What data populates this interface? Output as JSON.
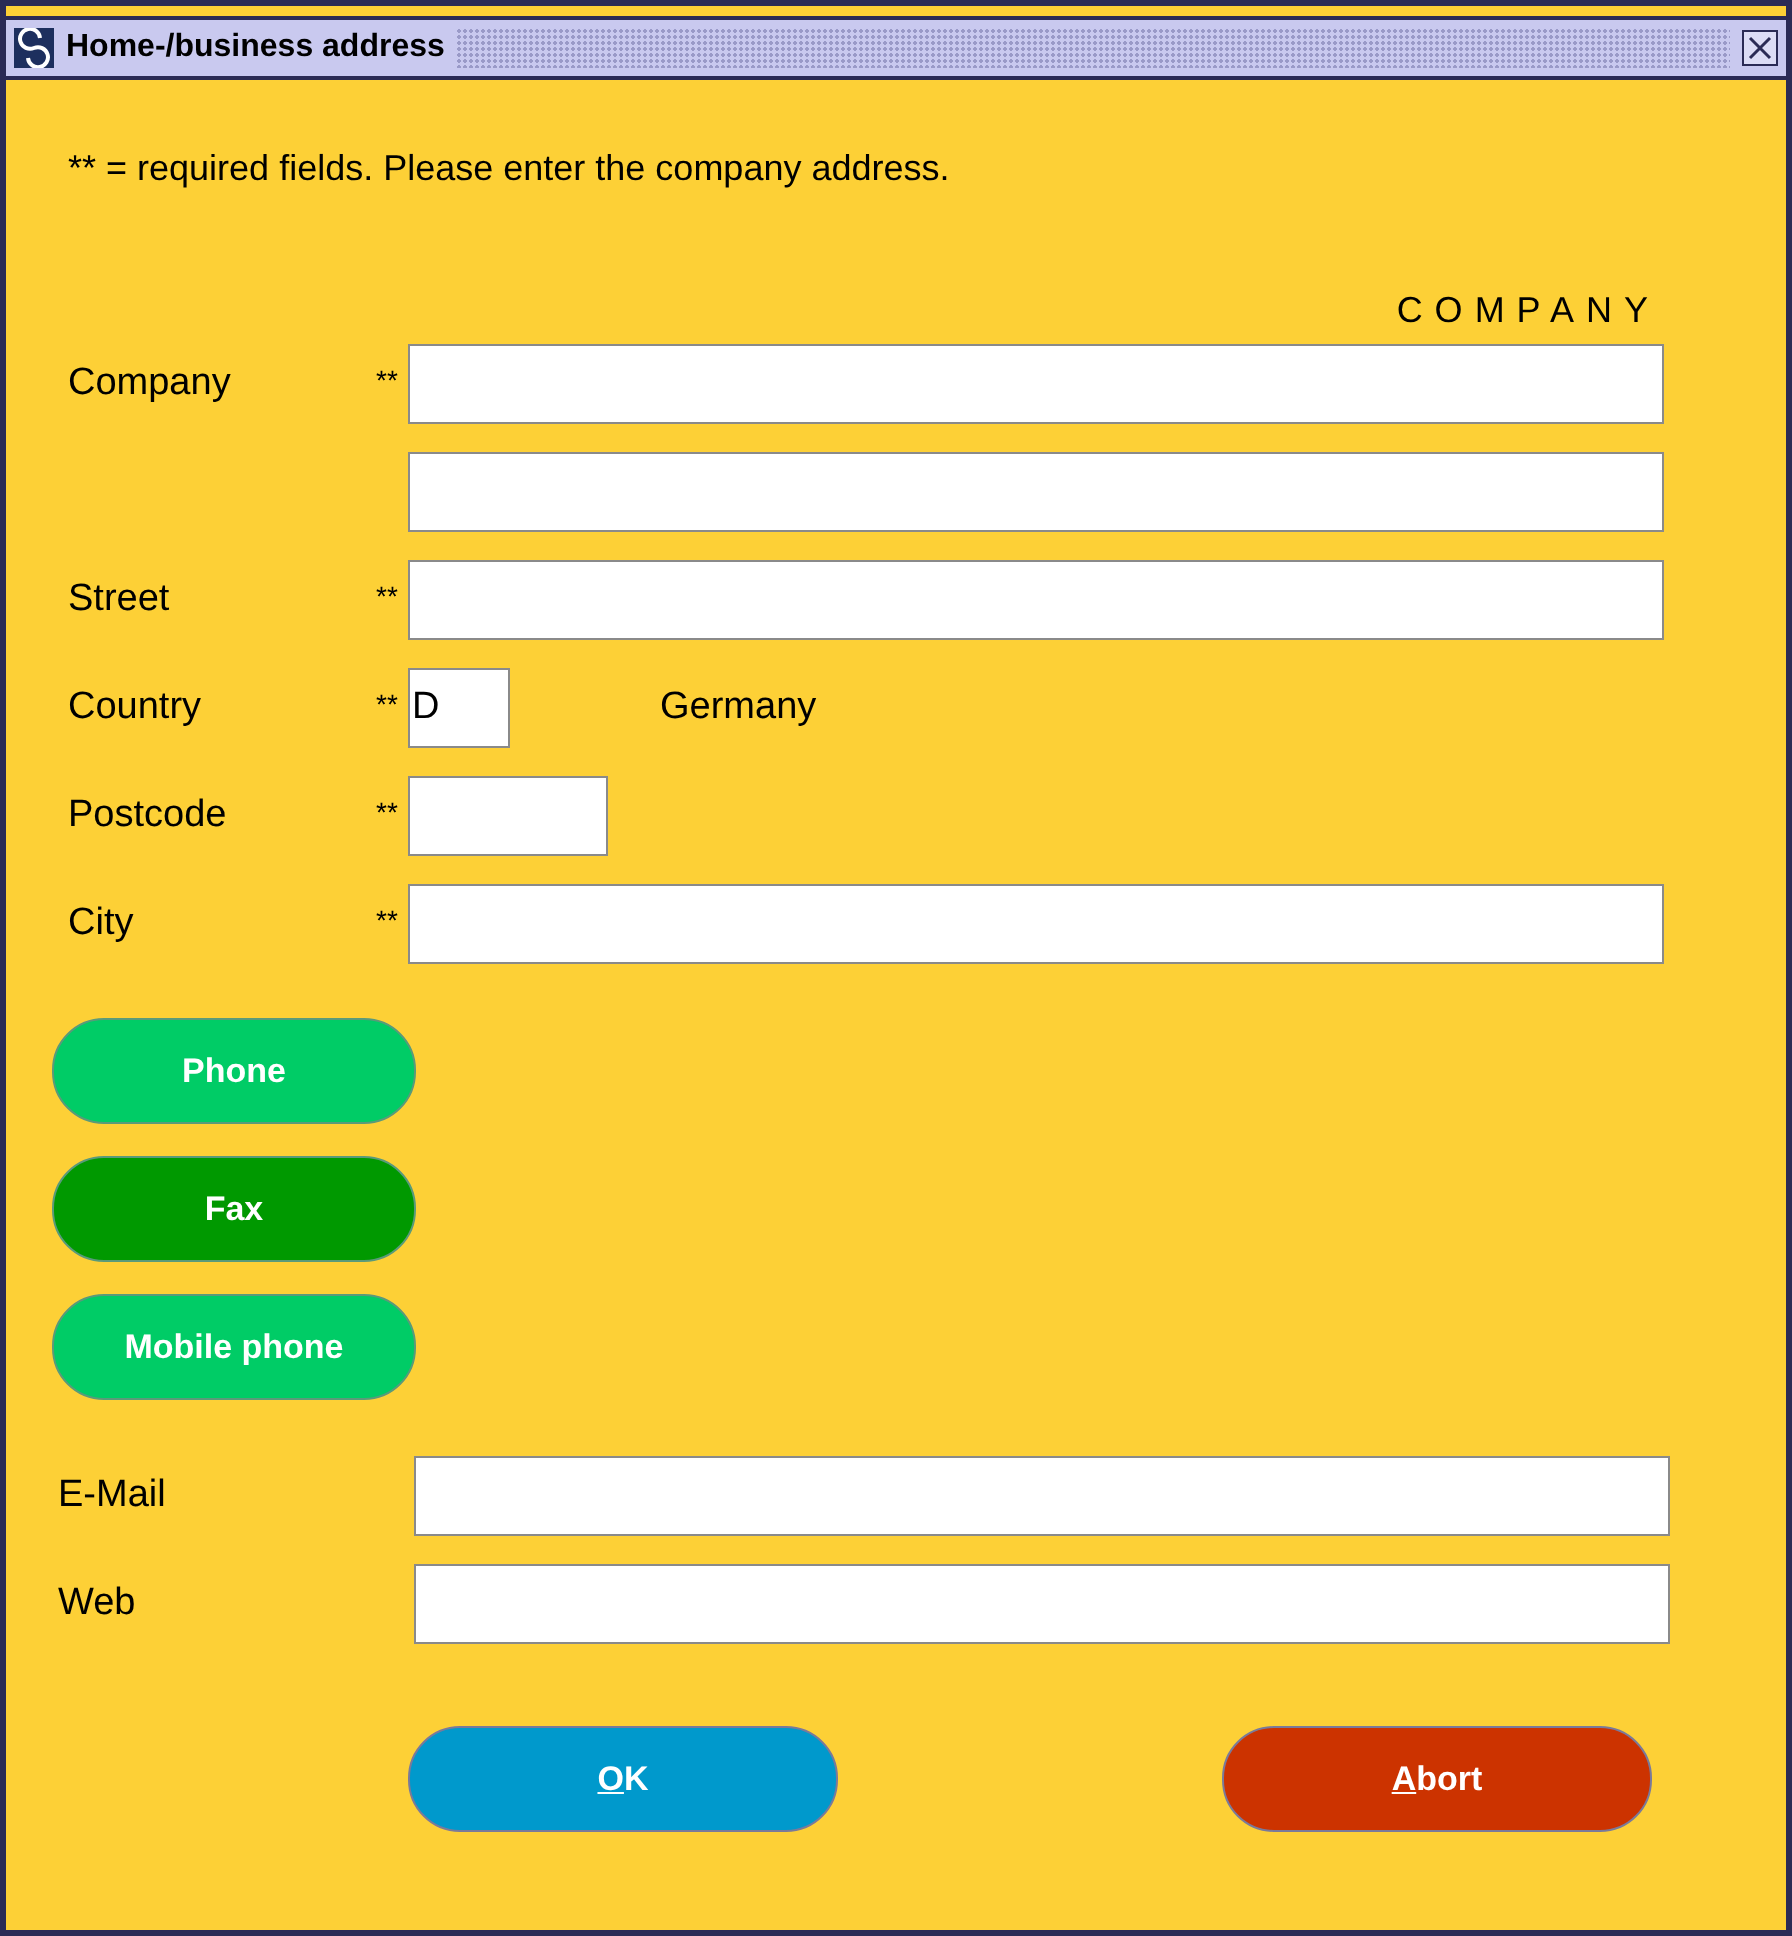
{
  "window": {
    "title": "Home-/business address"
  },
  "intro": "** = required fields. Please enter the company address.",
  "section_heading": "COMPANY",
  "address_rows": [
    {
      "kind": "wide",
      "label": "Company",
      "required_mark": "**"
    },
    {
      "kind": "wide"
    },
    {
      "kind": "wide",
      "label": "Street",
      "required_mark": "**"
    },
    {
      "kind": "tiny",
      "label": "Country",
      "required_mark": "**",
      "value": "D",
      "note": "Germany"
    },
    {
      "kind": "short",
      "label": "Postcode",
      "required_mark": "**"
    },
    {
      "kind": "wide",
      "label": "City",
      "required_mark": "**"
    }
  ],
  "phone_buttons": [
    {
      "label": "Phone",
      "selected": false
    },
    {
      "label": "Fax",
      "selected": true
    },
    {
      "label": "Mobile phone",
      "selected": false
    }
  ],
  "contact_rows": [
    {
      "label": "E-Mail"
    },
    {
      "label": "Web"
    }
  ],
  "actions": [
    {
      "kind": "confirm",
      "label_underlined": "O",
      "label_rest": "K"
    },
    {
      "kind": "cancel",
      "label_underlined": "A",
      "label_rest": "bort"
    }
  ]
}
